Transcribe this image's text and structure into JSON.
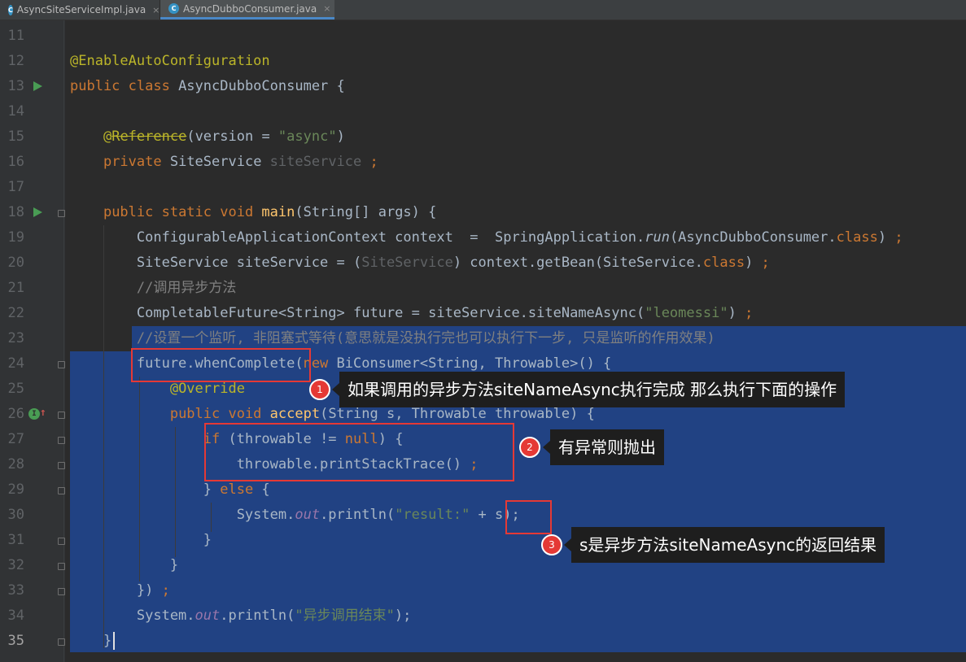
{
  "tabs": [
    {
      "label": "AsyncSiteServiceImpl.java",
      "close": "×"
    },
    {
      "label": "AsyncDubboConsumer.java",
      "close": "×"
    }
  ],
  "lines": [
    {
      "n": "11",
      "t": [
        {
          "c": "",
          "s": ""
        }
      ]
    },
    {
      "n": "12",
      "t": [
        {
          "c": "ann",
          "s": "@EnableAutoConfiguration"
        }
      ]
    },
    {
      "n": "13",
      "t": [
        {
          "c": "kw",
          "s": "public class "
        },
        {
          "c": "",
          "s": "AsyncDubboConsumer {"
        }
      ]
    },
    {
      "n": "14",
      "t": [
        {
          "c": "",
          "s": ""
        }
      ]
    },
    {
      "n": "15",
      "t": [
        {
          "c": "",
          "s": "    "
        },
        {
          "c": "ann",
          "s": "@"
        },
        {
          "c": "ann strike",
          "s": "Reference"
        },
        {
          "c": "",
          "s": "(version = "
        },
        {
          "c": "str",
          "s": "\"async\""
        },
        {
          "c": "",
          "s": ")"
        }
      ]
    },
    {
      "n": "16",
      "t": [
        {
          "c": "",
          "s": "    "
        },
        {
          "c": "kw",
          "s": "private "
        },
        {
          "c": "",
          "s": "SiteService "
        },
        {
          "c": "dim",
          "s": "siteService"
        },
        {
          "c": "kw",
          "s": " ;"
        }
      ]
    },
    {
      "n": "17",
      "t": [
        {
          "c": "",
          "s": ""
        }
      ]
    },
    {
      "n": "18",
      "t": [
        {
          "c": "",
          "s": "    "
        },
        {
          "c": "kw",
          "s": "public static void "
        },
        {
          "c": "fn",
          "s": "main"
        },
        {
          "c": "",
          "s": "(String[] args) {"
        }
      ]
    },
    {
      "n": "19",
      "t": [
        {
          "c": "",
          "s": "        ConfigurableApplicationContext context  =  SpringApplication."
        },
        {
          "c": "it",
          "s": "run"
        },
        {
          "c": "",
          "s": "(AsyncDubboConsumer."
        },
        {
          "c": "kw",
          "s": "class"
        },
        {
          "c": "",
          "s": ") "
        },
        {
          "c": "kw",
          "s": ";"
        }
      ]
    },
    {
      "n": "20",
      "t": [
        {
          "c": "",
          "s": "        SiteService siteService = ("
        },
        {
          "c": "dim",
          "s": "SiteService"
        },
        {
          "c": "",
          "s": ") context.getBean(SiteService."
        },
        {
          "c": "kw",
          "s": "class"
        },
        {
          "c": "",
          "s": ") "
        },
        {
          "c": "kw",
          "s": ";"
        }
      ]
    },
    {
      "n": "21",
      "t": [
        {
          "c": "",
          "s": "        "
        },
        {
          "c": "cm",
          "s": "//调用异步方法"
        }
      ]
    },
    {
      "n": "22",
      "t": [
        {
          "c": "",
          "s": "        CompletableFuture<String> future = siteService.siteNameAsync("
        },
        {
          "c": "str",
          "s": "\"leomessi\""
        },
        {
          "c": "",
          "s": ") "
        },
        {
          "c": "kw",
          "s": ";"
        }
      ]
    },
    {
      "n": "23",
      "t": [
        {
          "c": "",
          "s": "        "
        },
        {
          "c": "cm",
          "s": "//设置一个监听, 非阻塞式等待(意思就是没执行完也可以执行下一步, 只是监听的作用效果)"
        }
      ]
    },
    {
      "n": "24",
      "t": [
        {
          "c": "",
          "s": "        future.whenComplete("
        },
        {
          "c": "kw",
          "s": "new "
        },
        {
          "c": "",
          "s": "BiConsumer<String, Throwable>() {"
        }
      ]
    },
    {
      "n": "25",
      "t": [
        {
          "c": "",
          "s": "            "
        },
        {
          "c": "ann",
          "s": "@Override"
        }
      ]
    },
    {
      "n": "26",
      "t": [
        {
          "c": "",
          "s": "            "
        },
        {
          "c": "kw",
          "s": "public void "
        },
        {
          "c": "fn",
          "s": "accept"
        },
        {
          "c": "",
          "s": "(String s, Throwable throwable) {"
        }
      ]
    },
    {
      "n": "27",
      "t": [
        {
          "c": "",
          "s": "                "
        },
        {
          "c": "kw",
          "s": "if "
        },
        {
          "c": "",
          "s": "(throwable != "
        },
        {
          "c": "kw",
          "s": "null"
        },
        {
          "c": "",
          "s": ") {"
        }
      ]
    },
    {
      "n": "28",
      "t": [
        {
          "c": "",
          "s": "                    throwable.printStackTrace() "
        },
        {
          "c": "kw",
          "s": ";"
        }
      ]
    },
    {
      "n": "29",
      "t": [
        {
          "c": "",
          "s": "                } "
        },
        {
          "c": "kw",
          "s": "else "
        },
        {
          "c": "",
          "s": "{"
        }
      ]
    },
    {
      "n": "30",
      "t": [
        {
          "c": "",
          "s": "                    System."
        },
        {
          "c": "fld it",
          "s": "out"
        },
        {
          "c": "",
          "s": ".println("
        },
        {
          "c": "str",
          "s": "\"result:\""
        },
        {
          "c": "",
          "s": " + s);"
        }
      ]
    },
    {
      "n": "31",
      "t": [
        {
          "c": "",
          "s": "                }"
        }
      ]
    },
    {
      "n": "32",
      "t": [
        {
          "c": "",
          "s": "            }"
        }
      ]
    },
    {
      "n": "33",
      "t": [
        {
          "c": "",
          "s": "        }) "
        },
        {
          "c": "kw",
          "s": ";"
        }
      ]
    },
    {
      "n": "34",
      "t": [
        {
          "c": "",
          "s": "        System."
        },
        {
          "c": "fld it",
          "s": "out"
        },
        {
          "c": "",
          "s": ".println("
        },
        {
          "c": "str",
          "s": "\"异步调用结束\""
        },
        {
          "c": "",
          "s": ");"
        }
      ]
    },
    {
      "n": "35",
      "t": [
        {
          "c": "",
          "s": "    }"
        }
      ]
    }
  ],
  "annotations": [
    {
      "num": "1",
      "text": "如果调用的异步方法siteNameAsync执行完成 那么执行下面的操作"
    },
    {
      "num": "2",
      "text": "有异常则抛出"
    },
    {
      "num": "3",
      "text": "s是异步方法siteNameAsync的返回结果"
    }
  ]
}
